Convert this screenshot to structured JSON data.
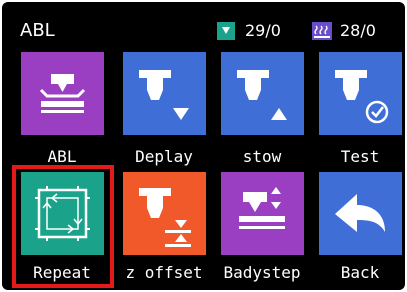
{
  "header": {
    "title": "ABL",
    "nozzle_temp": "29/0",
    "bed_temp": "28/0",
    "nozzle_icon": "nozzle-temp-icon",
    "bed_icon": "bed-heat-icon"
  },
  "tiles": [
    {
      "label": "ABL",
      "icon": "abl-level-icon",
      "color": "#9b3fc2"
    },
    {
      "label": "Deplay",
      "icon": "probe-deploy-icon",
      "color": "#3f6fd6"
    },
    {
      "label": "stow",
      "icon": "probe-stow-icon",
      "color": "#3f6fd6"
    },
    {
      "label": "Test",
      "icon": "probe-test-icon",
      "color": "#3f6fd6"
    },
    {
      "label": "Repeat",
      "icon": "repeat-grid-icon",
      "color": "#1aa38a",
      "selected": true
    },
    {
      "label": "z offset",
      "icon": "z-offset-icon",
      "color": "#f1592a"
    },
    {
      "label": "Badystep",
      "icon": "babystep-icon",
      "color": "#9b3fc2"
    },
    {
      "label": "Back",
      "icon": "back-arrow-icon",
      "color": "#3f6fd6"
    }
  ],
  "colors": {
    "background": "#000000",
    "selection": "#e21a1a",
    "nozzle_icon": "#1aa38a",
    "bed_icon": "#6a4dc8"
  }
}
